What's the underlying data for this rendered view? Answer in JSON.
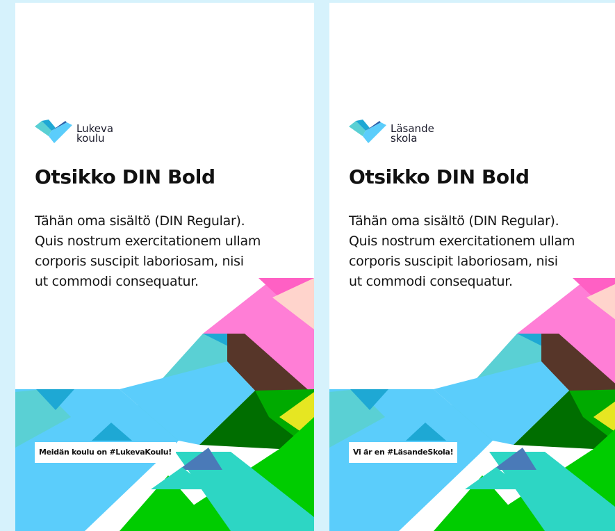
{
  "cards": [
    {
      "logo": {
        "line1": "Lukeva",
        "line2": "koulu"
      },
      "headline": "Otsikko DIN Bold",
      "body_lines": [
        "Tähän oma sisältö (DIN Regular).",
        "Quis nostrum exercitationem ullam",
        "corporis suscipit laboriosam, nisi",
        "ut commodi consequatur."
      ],
      "tag": "Meidän koulu on #LukevaKoulu!"
    },
    {
      "logo": {
        "line1": "Läsande",
        "line2": "skola"
      },
      "headline": "Otsikko DIN Bold",
      "body_lines": [
        "Tähän oma sisältö (DIN Regular).",
        "Quis nostrum exercitationem ullam",
        "corporis suscipit laboriosam, nisi",
        "ut commodi consequatur."
      ],
      "tag": "Vi är en #LäsandeSkola!"
    }
  ],
  "colors": {
    "background": "#d6f2fc",
    "pink": "#ff7ed6",
    "light_blue": "#5bcdfb",
    "teal": "#5ad0d4",
    "brown": "#573629",
    "green": "#00cc00",
    "dark_green": "#006e00",
    "yellow": "#e6e622",
    "turquoise": "#2dd6c4"
  }
}
